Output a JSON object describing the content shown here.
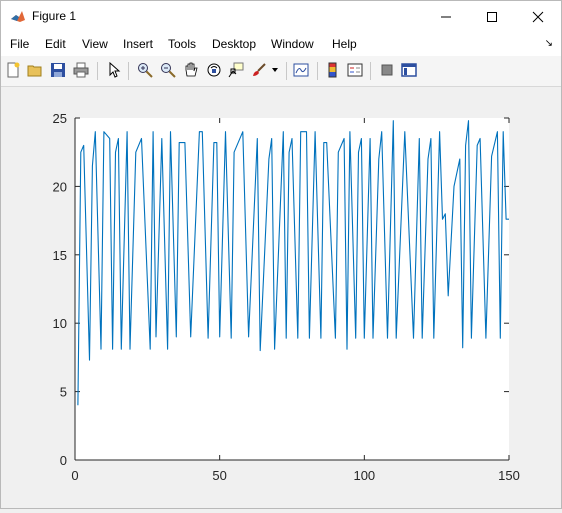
{
  "window": {
    "title": "Figure 1"
  },
  "menu": {
    "items": [
      "File",
      "Edit",
      "View",
      "Insert",
      "Tools",
      "Desktop",
      "Window",
      "Help"
    ]
  },
  "toolbar": {
    "icons": [
      "new-figure-icon",
      "open-file-icon",
      "save-icon",
      "print-icon",
      "pointer-icon",
      "zoom-in-icon",
      "zoom-out-icon",
      "pan-icon",
      "rotate-3d-icon",
      "data-cursor-icon",
      "brush-icon",
      "brush-dropdown-icon",
      "link-plot-icon",
      "colorbar-icon",
      "legend-icon",
      "hide-plot-tools-icon",
      "show-plot-tools-icon"
    ]
  },
  "chart_data": {
    "type": "line",
    "title": "",
    "xlabel": "",
    "ylabel": "",
    "xlim": [
      0,
      150
    ],
    "ylim": [
      0,
      25
    ],
    "xticks": [
      0,
      50,
      100,
      150
    ],
    "yticks": [
      0,
      5,
      10,
      15,
      20,
      25
    ],
    "grid": false,
    "line_color": "#0072BD",
    "series": [
      {
        "x": [
          1,
          2,
          3,
          5,
          6,
          7,
          9,
          10,
          12,
          13,
          14,
          15,
          16,
          18,
          19,
          21,
          23,
          26,
          27,
          28,
          30,
          32,
          33,
          35,
          36,
          38,
          40,
          43,
          44,
          46,
          48,
          49,
          50,
          52,
          54,
          55,
          58,
          60,
          63,
          64,
          67,
          68,
          69,
          72,
          73,
          74,
          75,
          77,
          78,
          80,
          81,
          83,
          85,
          86,
          87,
          90,
          91,
          93,
          94,
          95,
          97,
          98,
          99,
          100,
          102,
          103,
          105,
          106,
          108,
          110,
          111,
          114,
          117,
          119,
          120,
          122,
          123,
          124,
          126,
          127,
          128,
          129,
          131,
          133,
          134,
          135,
          136,
          137,
          139,
          140,
          142,
          144,
          146,
          147,
          148,
          149,
          150
        ],
        "y": [
          4,
          22.5,
          23,
          7.3,
          21.5,
          24,
          8.1,
          24,
          23.5,
          8.1,
          22.5,
          23.5,
          8.1,
          24,
          8.1,
          22.5,
          23.5,
          8.1,
          24,
          9,
          23.5,
          8.1,
          24,
          9,
          23.2,
          23.2,
          9,
          24,
          24,
          8.9,
          23.2,
          23.2,
          9,
          24,
          8.9,
          22.5,
          24,
          9,
          23.5,
          8,
          22,
          23.5,
          8.1,
          24,
          8.9,
          22.5,
          23.5,
          8.9,
          24,
          24,
          8.9,
          24,
          8.9,
          23.2,
          23.2,
          8.9,
          22.5,
          23.5,
          8.1,
          24,
          8.9,
          22.5,
          23.5,
          8.9,
          23.5,
          8.9,
          22,
          24,
          8.9,
          24.8,
          8.9,
          24,
          8.9,
          23.5,
          8.9,
          22,
          23.5,
          8.9,
          24,
          17.6,
          18,
          12,
          20,
          22,
          8.2,
          23,
          24.8,
          8.9,
          23,
          23.5,
          8.9,
          22.2,
          24,
          8.9,
          24,
          17.6,
          17.6
        ]
      }
    ]
  }
}
